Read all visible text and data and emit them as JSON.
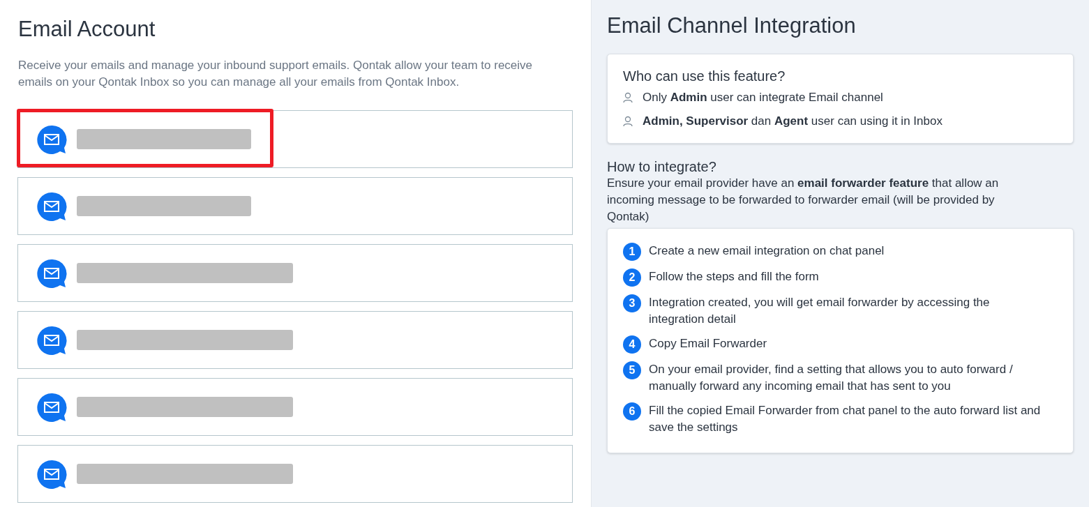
{
  "email_account": {
    "title": "Email Account",
    "description": "Receive your emails and manage your inbound support emails. Qontak allow your team to receive emails on your Qontak Inbox so you can manage all your emails from Qontak Inbox.",
    "accounts": [
      {
        "highlighted": true
      },
      {
        "highlighted": false
      },
      {
        "highlighted": false
      },
      {
        "highlighted": false
      },
      {
        "highlighted": false
      },
      {
        "highlighted": false
      }
    ]
  },
  "integration": {
    "title": "Email Channel Integration",
    "who": {
      "heading": "Who can use this feature?",
      "items": [
        "Only **Admin** user can integrate Email channel",
        "**Admin, Supervisor** dan **Agent** user can using it in Inbox"
      ]
    },
    "how": {
      "heading": "How to integrate?",
      "description": "Ensure your email provider have an **email forwarder feature** that allow an incoming message to be forwarded to forwarder email (will be provided by Qontak)",
      "steps": [
        {
          "number": "1",
          "text": "Create a new email integration on chat panel"
        },
        {
          "number": "2",
          "text": "Follow the steps and fill the form"
        },
        {
          "number": "3",
          "text": "Integration created, you will get email forwarder by accessing the integration detail"
        },
        {
          "number": "4",
          "text": "Copy Email Forwarder"
        },
        {
          "number": "5",
          "text": "On your email provider, find a setting that allows you to auto forward / manually forward any incoming email that has sent to you"
        },
        {
          "number": "6",
          "text": "Fill the copied Email Forwarder from chat panel to the auto forward list and save the settings"
        }
      ]
    }
  }
}
